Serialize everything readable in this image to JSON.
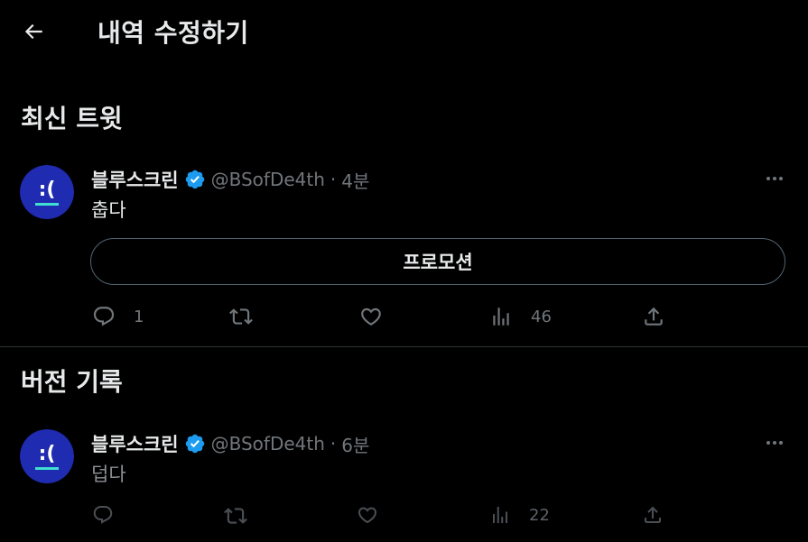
{
  "header": {
    "title": "내역 수정하기",
    "back_icon": "arrow-left-icon"
  },
  "latest": {
    "section_title": "최신 트윗",
    "tweet": {
      "name": "블루스크린",
      "handle": "@BSofDe4th",
      "separator": "·",
      "time": "4분",
      "text": "춥다",
      "promo_label": "프로모션",
      "replies": "1",
      "retweets": "",
      "likes": "",
      "views": "46"
    }
  },
  "history": {
    "section_title": "버전 기록",
    "tweet": {
      "name": "블루스크린",
      "handle": "@BSofDe4th",
      "separator": "·",
      "time": "6분",
      "text": "덥다",
      "replies": "",
      "retweets": "",
      "likes": "",
      "views": "22"
    }
  },
  "avatar": {
    "face": ":("
  },
  "colors": {
    "background": "#000000",
    "text": "#e7e9ea",
    "muted": "#71767b",
    "verified": "#1d9bf0",
    "avatar_bg": "#1f2bb0",
    "avatar_bar": "#3fe0d0"
  }
}
